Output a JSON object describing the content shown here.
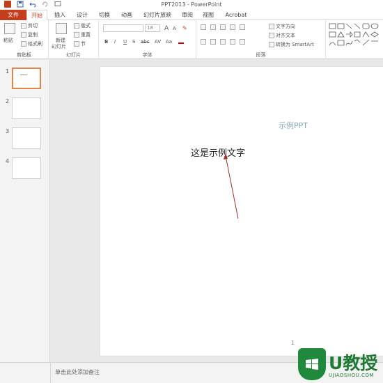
{
  "window": {
    "title": "PPT2013 - PowerPoint"
  },
  "tabs": [
    {
      "label": "文件"
    },
    {
      "label": "开始"
    },
    {
      "label": "插入"
    },
    {
      "label": "设计"
    },
    {
      "label": "切换"
    },
    {
      "label": "动画"
    },
    {
      "label": "幻灯片放映"
    },
    {
      "label": "审阅"
    },
    {
      "label": "视图"
    },
    {
      "label": "Acrobat"
    }
  ],
  "ribbon": {
    "clipboard": {
      "paste": "粘贴",
      "cut": "剪切",
      "copy": "复制",
      "format_painter": "格式刷",
      "label": "剪贴板"
    },
    "slides": {
      "new_slide": "新建",
      "new_slide2": "幻灯片",
      "layout": "版式",
      "reset": "重置",
      "section": "节",
      "label": "幻灯片"
    },
    "font": {
      "size": "18",
      "label": "字体",
      "bold": "B",
      "italic": "I",
      "underline": "U",
      "strike": "S",
      "shadow": "abc",
      "spacing": "AV",
      "case": "Aa",
      "grow": "A",
      "shrink": "A"
    },
    "paragraph": {
      "text_direction": "文字方向",
      "align_text": "对齐文本",
      "smartart": "转换为 SmartArt",
      "label": "段落"
    }
  },
  "thumbnails": [
    {
      "num": "1"
    },
    {
      "num": "2"
    },
    {
      "num": "3"
    },
    {
      "num": "4"
    }
  ],
  "slide": {
    "title": "示例PPT",
    "body": "这是示例文字",
    "number": "1"
  },
  "notes": {
    "placeholder": "单击此处添加备注"
  },
  "watermark": {
    "brand": "U教授",
    "site": "UJIAOSHOU.COM"
  },
  "colors": {
    "accent": "#c43e1c",
    "arrow": "#a0302a",
    "watermark": "#1f8a3c"
  }
}
